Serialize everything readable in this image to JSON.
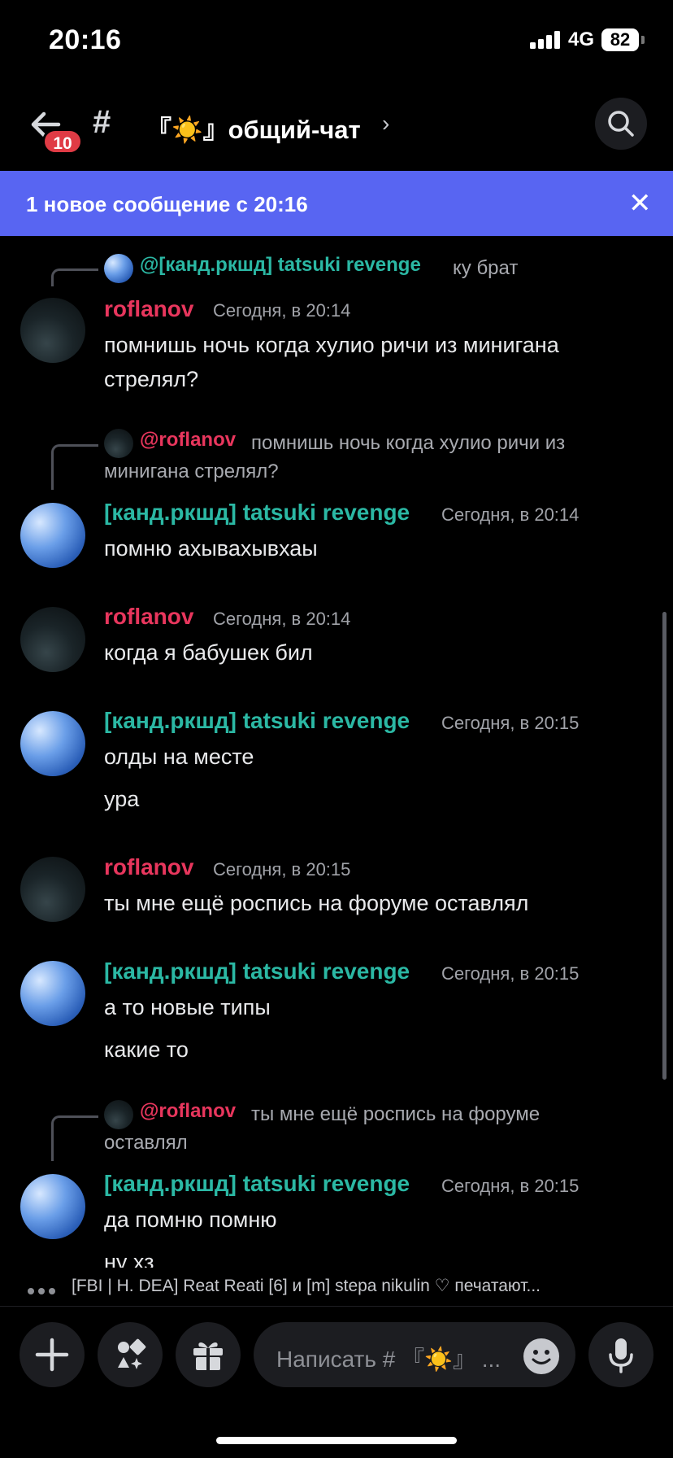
{
  "status_bar": {
    "time": "20:16",
    "network": "4G",
    "battery": "82"
  },
  "header": {
    "back_badge": "10",
    "hash": "#",
    "channel_name": "『☀️』общий-чат",
    "chevron": "›"
  },
  "banner": {
    "text": "1 новое сообщение с 20:16",
    "close": "✕"
  },
  "messages": [
    {
      "reply_mention": "@[канд.ркшд] tatsuki revenge",
      "reply_text": "ку брат",
      "author": "roflanov",
      "time": "Сегодня, в 20:14",
      "lines": [
        "помнишь ночь когда хулио ричи из минигана",
        "стрелял?"
      ]
    },
    {
      "reply_mention": "@roflanov",
      "reply_text": "помнишь ночь когда хулио ричи из",
      "reply_text2": "минигана стрелял?",
      "author": "[канд.ркшд] tatsuki revenge",
      "time": "Сегодня, в 20:14",
      "lines": [
        "помню ахывахывхаы"
      ]
    },
    {
      "author": "roflanov",
      "time": "Сегодня, в 20:14",
      "lines": [
        "когда я бабушек бил"
      ]
    },
    {
      "author": "[канд.ркшд] tatsuki revenge",
      "time": "Сегодня, в 20:15",
      "lines": [
        "олды на месте",
        "ура"
      ]
    },
    {
      "author": "roflanov",
      "time": "Сегодня, в 20:15",
      "lines": [
        "ты мне ещё роспись на форуме оставлял"
      ]
    },
    {
      "author": "[канд.ркшд] tatsuki revenge",
      "time": "Сегодня, в 20:15",
      "lines": [
        "а то новые типы",
        "какие то"
      ]
    },
    {
      "reply_mention": "@roflanov",
      "reply_text": "ты мне ещё роспись на форуме",
      "reply_text2": "оставлял",
      "author": "[канд.ркшд] tatsuki revenge",
      "time": "Сегодня, в 20:15",
      "lines": [
        "да помню помню",
        "ну хз"
      ]
    }
  ],
  "typing": {
    "text": "[FBI | H. DEA] Reat Reati [6] и [m] stepa nikulin ♡ печатают..."
  },
  "composer": {
    "placeholder": "Написать # 『☀️』 ..."
  },
  "colors": {
    "accent": "#5865f2",
    "name_red": "#e8365d",
    "name_teal": "#2bb8a4",
    "badge": "#e03b45"
  }
}
